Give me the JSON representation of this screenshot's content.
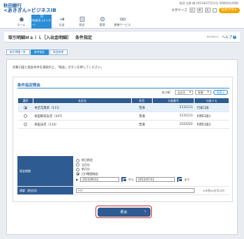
{
  "header": {
    "bank_line1": "秋田銀行",
    "bank_line2": "<あきぎん>ビジネスIB",
    "info": "秋田 太郎 様 2012年07月12日 09時30分00秒",
    "font_size_label": "文字サイズ",
    "font_small": "小",
    "font_medium": "中",
    "font_large": "大",
    "logout": "ログアウト"
  },
  "nav": [
    {
      "label": "ホーム",
      "icon": "home-icon"
    },
    {
      "label": "ANSER (アンサー)",
      "icon": "document-icon"
    },
    {
      "label": "伝送",
      "icon": "transmit-icon"
    },
    {
      "label": "照会",
      "icon": "inquiry-icon"
    },
    {
      "label": "管理",
      "icon": "settings-icon"
    },
    {
      "label": "連携サービス",
      "icon": "link-icon"
    }
  ],
  "title": {
    "main": "取引明細Ｍａｉｌ［入出金明細］",
    "sub": "条件指定",
    "screen_id": "BAMN003",
    "help": "ヘルプ"
  },
  "steps": [
    "取引明細一覧",
    "条件指定",
    "照会結果"
  ],
  "instruction": "対象口座と照会条件を選択の上、「照会」ボタンを押してください。",
  "section": {
    "title": "条件指定照会",
    "sort_label": "並び順：",
    "sort_key": "支店名",
    "sort_order": "昇順",
    "resort": "再表示"
  },
  "table": {
    "headers": [
      "選択",
      "支店名",
      "科目",
      "口座番号",
      "口座メモ"
    ],
    "rows": [
      {
        "branch": "本店営業部（111）",
        "type": "普通",
        "number": "1111111",
        "memo": "代表口座",
        "selected": true
      },
      {
        "branch": "秋田駅前支店（147）",
        "type": "普通",
        "number": "1111111",
        "memo": "利用口座1",
        "selected": false
      },
      {
        "branch": "秋田支店（114）",
        "type": "普通",
        "number": "2222222",
        "memo": "利用口座2",
        "selected": false
      }
    ]
  },
  "form": {
    "period_label": "照会期間",
    "options": [
      "前日照会",
      "当月分",
      "前月分",
      "日付範囲指定"
    ],
    "selected_option": 3,
    "date_from": "2012/06/12",
    "from_label": "から",
    "date_to": "2012/07/12",
    "to_label": "まで",
    "memo_label": "摘要（照会用）",
    "memo_value": "ｱｲｳ",
    "memo_hint": "※半角40文字以内"
  },
  "submit": "照会"
}
